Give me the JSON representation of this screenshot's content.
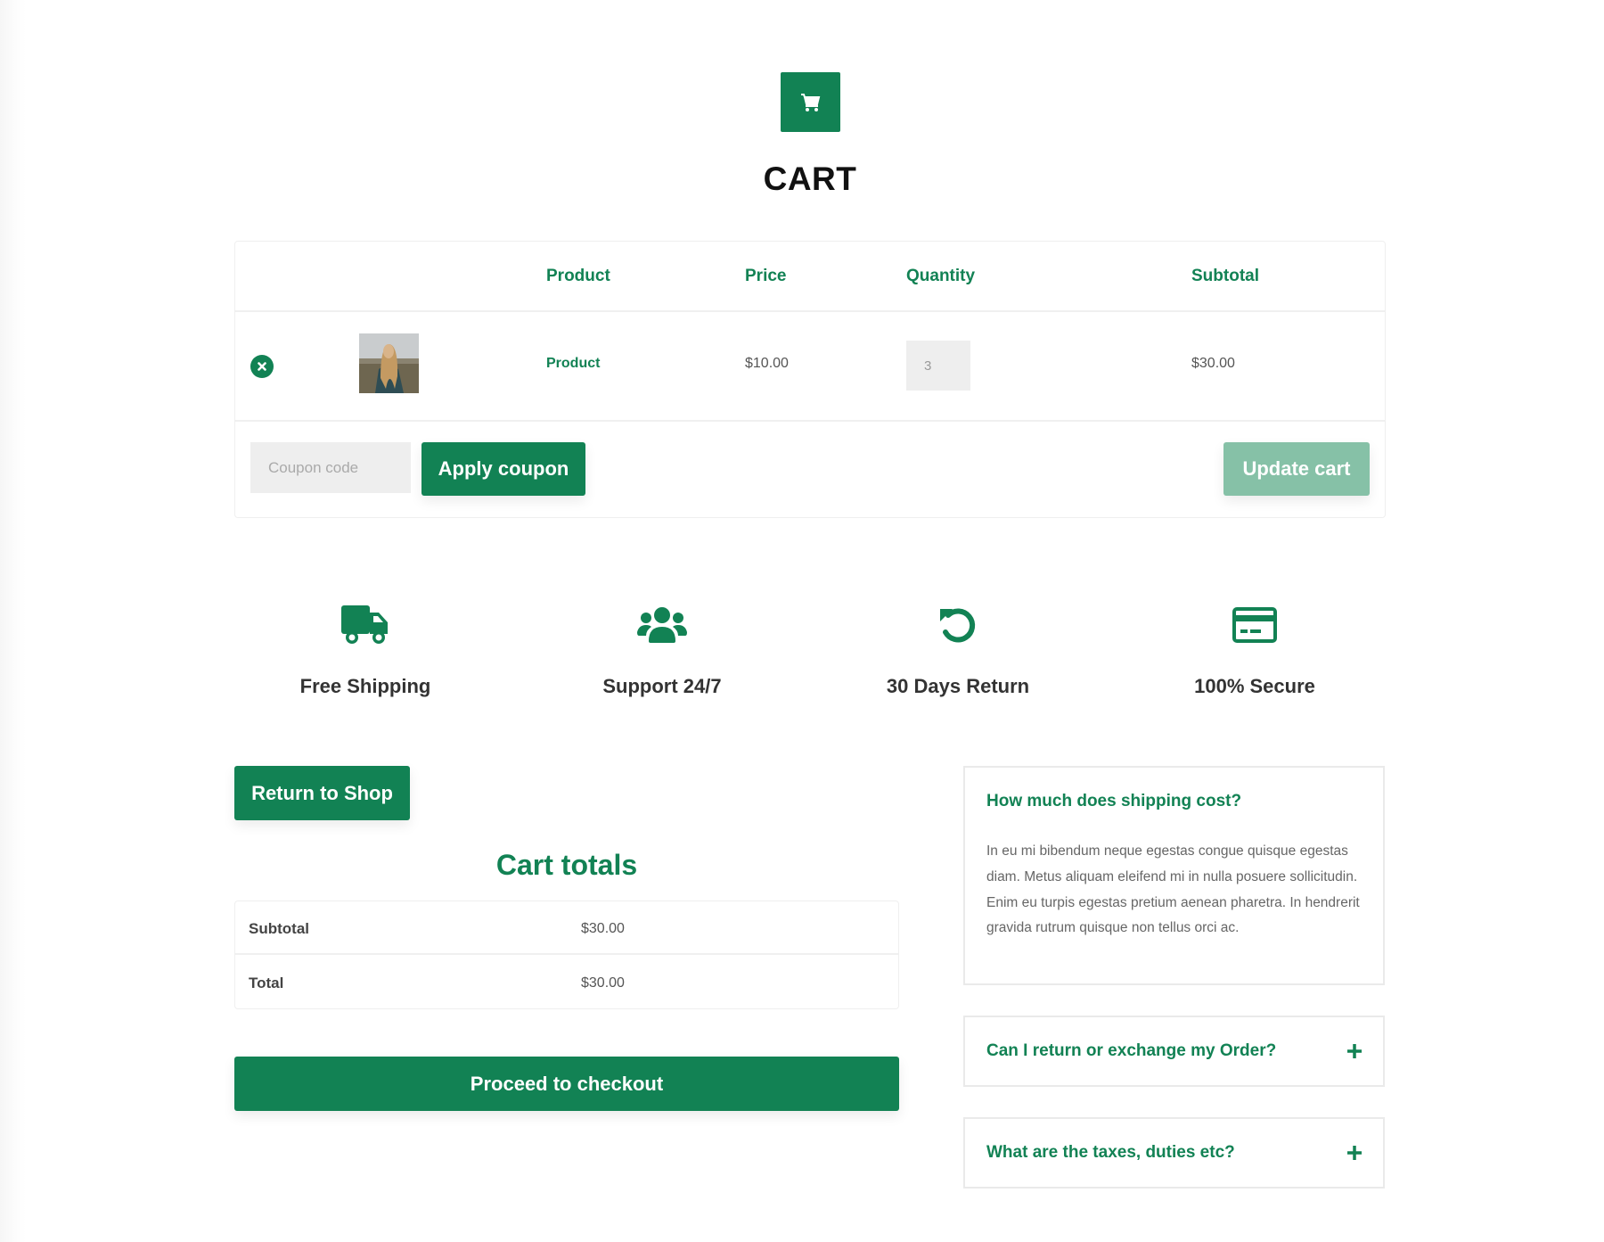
{
  "header": {
    "icon": "shopping-cart-icon",
    "title": "CART"
  },
  "colors": {
    "brand": "#128254",
    "brand_muted": "#86c1a7",
    "input_bg": "#eeeeee"
  },
  "cart_table": {
    "columns": [
      "",
      "",
      "Product",
      "Price",
      "Quantity",
      "Subtotal"
    ],
    "rows": [
      {
        "remove_icon": "remove-circle-x-icon",
        "image_alt": "product-thumbnail-woman",
        "product": "Product",
        "price": "$10.00",
        "quantity": "3",
        "subtotal": "$30.00"
      }
    ],
    "coupon_placeholder": "Coupon code",
    "coupon_value": "",
    "apply_coupon_label": "Apply coupon",
    "update_cart_label": "Update cart"
  },
  "features": [
    {
      "icon": "truck-icon",
      "label": "Free Shipping"
    },
    {
      "icon": "users-icon",
      "label": "Support 24/7"
    },
    {
      "icon": "undo-icon",
      "label": "30 Days Return"
    },
    {
      "icon": "credit-card-icon",
      "label": "100% Secure"
    }
  ],
  "return_to_shop_label": "Return to Shop",
  "cart_totals": {
    "title": "Cart totals",
    "rows": [
      {
        "label": "Subtotal",
        "value": "$30.00"
      },
      {
        "label": "Total",
        "value": "$30.00"
      }
    ],
    "checkout_label": "Proceed to checkout"
  },
  "faq": [
    {
      "question": "How much does shipping cost?",
      "answer": "In eu mi bibendum neque egestas congue quisque egestas diam. Metus aliquam eleifend mi in nulla posuere sollicitudin. Enim eu turpis egestas pretium aenean pharetra. In hendrerit gravida rutrum quisque non tellus orci ac.",
      "expanded": true
    },
    {
      "question": "Can I return or exchange my Order?",
      "expanded": false
    },
    {
      "question": "What are the taxes, duties etc?",
      "expanded": false
    }
  ]
}
